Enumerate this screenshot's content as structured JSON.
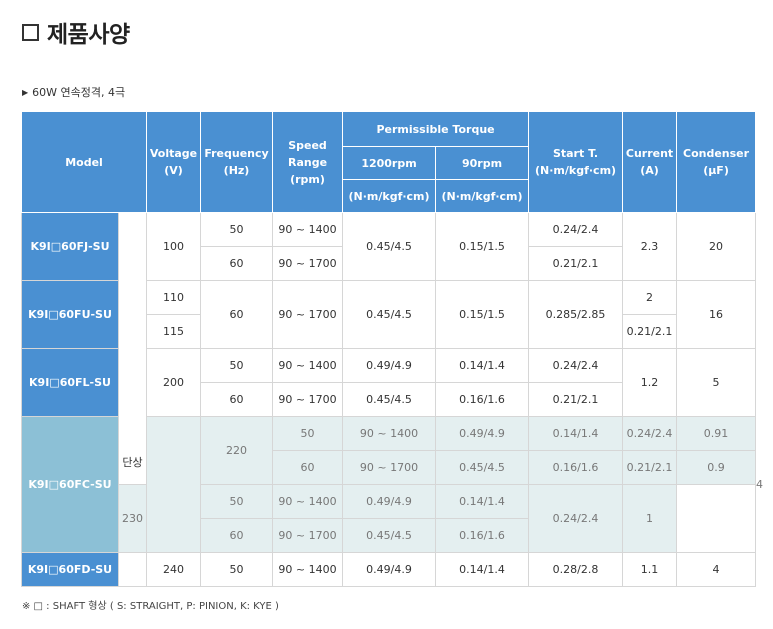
{
  "title": "제품사양",
  "subtitle": "60W 연속정격, 4극",
  "headers": {
    "model": "Model",
    "voltage": "Voltage\n(V)",
    "frequency": "Frequency\n(Hz)",
    "speed": "Speed\nRange\n(rpm)",
    "torque": "Permissible Torque",
    "rpm1200": "1200rpm",
    "rpm90": "90rpm",
    "unit": "(N·m/kgf·cm)",
    "start": "Start T.\n(N·m/kgf·cm)",
    "current": "Current\n(A)",
    "condenser": "Condenser\n(μF)"
  },
  "phase": "단상",
  "models": {
    "fj": "K9I□60FJ-SU",
    "fu": "K9I□60FU-SU",
    "fl": "K9I□60FL-SU",
    "fc": "K9I□60FC-SU",
    "fd": "K9I□60FD-SU"
  },
  "cells": {
    "fj_v": "100",
    "fj_f1": "50",
    "fj_s1": "90 ~ 1400",
    "fj_f2": "60",
    "fj_s2": "90 ~ 1700",
    "fj_t1200": "0.45/4.5",
    "fj_t90": "0.15/1.5",
    "fj_st1": "0.24/2.4",
    "fj_st2": "0.21/2.1",
    "fj_cur": "2.3",
    "fj_cond": "20",
    "fu_v1": "110",
    "fu_v2": "115",
    "fu_f": "60",
    "fu_s": "90 ~ 1700",
    "fu_t1200": "0.45/4.5",
    "fu_t90": "0.15/1.5",
    "fu_st": "0.285/2.85",
    "fu_cur1": "2",
    "fu_cur2": "0.21/2.1",
    "fu_cond": "16",
    "fl_v": "200",
    "fl_f1": "50",
    "fl_s1": "90 ~ 1400",
    "fl_t1200_1": "0.49/4.9",
    "fl_t90_1": "0.14/1.4",
    "fl_st1": "0.24/2.4",
    "fl_f2": "60",
    "fl_s2": "90 ~ 1700",
    "fl_t1200_2": "0.45/4.5",
    "fl_t90_2": "0.16/1.6",
    "fl_st2": "0.21/2.1",
    "fl_cur": "1.2",
    "fl_cond": "5",
    "fc_v1": "220",
    "fc_r1_f": "50",
    "fc_r1_s": "90 ~ 1400",
    "fc_r1_t1200": "0.49/4.9",
    "fc_r1_t90": "0.14/1.4",
    "fc_r1_st": "0.24/2.4",
    "fc_r1_cur": "0.91",
    "fc_cond": "4",
    "fc_r2_f": "60",
    "fc_r2_s": "90 ~ 1700",
    "fc_r2_t1200": "0.45/4.5",
    "fc_r2_t90": "0.16/1.6",
    "fc_r2_st": "0.21/2.1",
    "fc_r2_cur": "0.9",
    "fc_v2": "230",
    "fc_r3_f": "50",
    "fc_r3_s": "90 ~ 1400",
    "fc_r3_t1200": "0.49/4.9",
    "fc_r3_t90": "0.14/1.4",
    "fc_r34_st": "0.24/2.4",
    "fc_r34_cur": "1",
    "fc_r4_f": "60",
    "fc_r4_s": "90 ~ 1700",
    "fc_r4_t1200": "0.45/4.5",
    "fc_r4_t90": "0.16/1.6",
    "fd_v": "240",
    "fd_f": "50",
    "fd_s": "90 ~ 1400",
    "fd_t1200": "0.49/4.9",
    "fd_t90": "0.14/1.4",
    "fd_st": "0.28/2.8",
    "fd_cur": "1.1",
    "fd_cond": "4"
  },
  "footnote": "※ □ : SHAFT 형상 ( S: STRAIGHT, P: PINION, K: KYE )"
}
